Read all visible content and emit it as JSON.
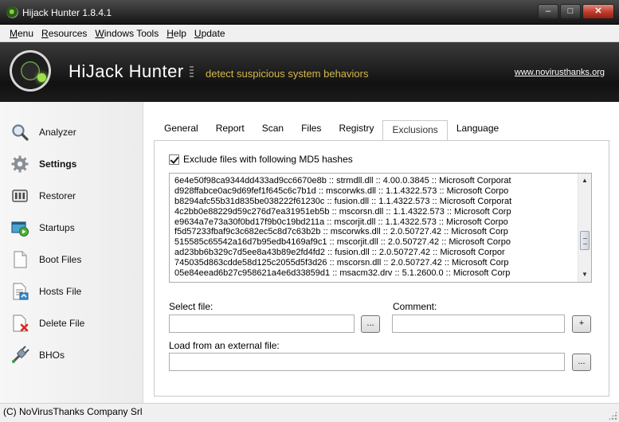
{
  "window": {
    "title": "Hijack Hunter 1.8.4.1",
    "buttons": {
      "minimize": "–",
      "maximize": "□",
      "close": "✕"
    }
  },
  "menubar": [
    {
      "first": "M",
      "rest": "enu"
    },
    {
      "first": "R",
      "rest": "esources"
    },
    {
      "first": "W",
      "rest": "indows Tools"
    },
    {
      "first": "H",
      "rest": "elp"
    },
    {
      "first": "U",
      "rest": "pdate"
    }
  ],
  "header": {
    "brand_bold": "HiJack",
    "brand_rest": " Hunter",
    "tagline": "detect suspicious system behaviors",
    "site": "www.novirusthanks.org"
  },
  "sidebar": {
    "items": [
      {
        "label": "Analyzer",
        "icon": "magnifier-icon"
      },
      {
        "label": "Settings",
        "icon": "gear-icon"
      },
      {
        "label": "Restorer",
        "icon": "restore-icon"
      },
      {
        "label": "Startups",
        "icon": "startup-icon"
      },
      {
        "label": "Boot Files",
        "icon": "document-icon"
      },
      {
        "label": "Hosts File",
        "icon": "hosts-file-icon"
      },
      {
        "label": "Delete File",
        "icon": "delete-file-icon"
      },
      {
        "label": "BHOs",
        "icon": "plugin-icon"
      }
    ]
  },
  "tabs": [
    "General",
    "Report",
    "Scan",
    "Files",
    "Registry",
    "Exclusions",
    "Language"
  ],
  "exclusions": {
    "checkbox_label": "Exclude files with following MD5 hashes",
    "checked": true,
    "hashes": [
      "6e4e50f98ca9344dd433ad9cc6670e8b :: strmdll.dll :: 4.00.0.3845 :: Microsoft Corporat",
      "d928ffabce0ac9d69fef1f645c6c7b1d :: mscorwks.dll :: 1.1.4322.573 :: Microsoft Corpo",
      "b8294afc55b31d835be038222f61230c :: fusion.dll :: 1.1.4322.573 :: Microsoft Corporat",
      "4c2bb0e88229d59c276d7ea31951eb5b :: mscorsn.dll :: 1.1.4322.573 :: Microsoft Corp",
      "e9634a7e73a30f0bd17f9b0c19bd211a :: mscorjit.dll :: 1.1.4322.573 :: Microsoft Corpo",
      "f5d57233fbaf9c3c682ec5c8d7c63b2b :: mscorwks.dll :: 2.0.50727.42 :: Microsoft Corp",
      "515585c65542a16d7b95edb4169af9c1 :: mscorjit.dll :: 2.0.50727.42 :: Microsoft Corpo",
      "ad23bb6b329c7d5ee8a43b89e2fd4fd2 :: fusion.dll :: 2.0.50727.42 :: Microsoft Corpor",
      "745035d863cdde58d125c2055d5f3d26 :: mscorsn.dll :: 2.0.50727.42 :: Microsoft Corp",
      "05e84eead6b27c958621a4e6d33859d1 :: msacm32.drv :: 5.1.2600.0 :: Microsoft Corp"
    ],
    "select_file_label": "Select file:",
    "comment_label": "Comment:",
    "load_label": "Load from an external file:",
    "select_file_value": "",
    "comment_value": "",
    "load_value": "",
    "browse_label": "...",
    "add_label": "+",
    "load_browse_label": "..."
  },
  "statusbar": {
    "text": "(C) NoVirusThanks Company Srl"
  }
}
